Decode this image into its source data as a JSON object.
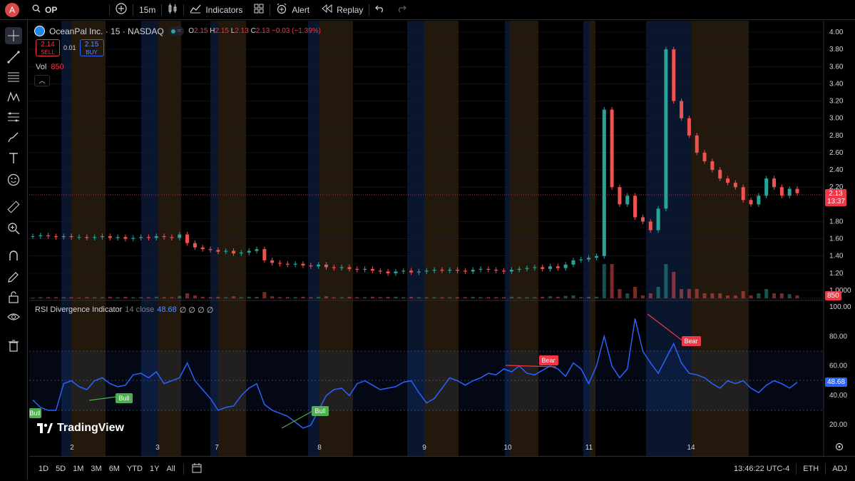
{
  "toolbar": {
    "avatar_letter": "A",
    "symbol": "OP",
    "interval": "15m",
    "indicators_label": "Indicators",
    "alert_label": "Alert",
    "replay_label": "Replay"
  },
  "legend": {
    "title": "OceanPal Inc. · 15 · NASDAQ",
    "o_label": "O",
    "o_val": "2.15",
    "h_label": "H",
    "h_val": "2.15",
    "l_label": "L",
    "l_val": "2.13",
    "c_label": "C",
    "c_val": "2.13",
    "change": "−0.03 (−1.39%)",
    "sell_price": "2.14",
    "sell_label": "SELL",
    "spread": "0.01",
    "buy_price": "2.15",
    "buy_label": "BUY",
    "vol_label": "Vol",
    "vol_val": "850"
  },
  "rsi_legend": {
    "name": "RSI Divergence Indicator",
    "params": "14 close",
    "value": "48.68",
    "zeros": "∅ ∅ ∅ ∅"
  },
  "brand": "TradingView",
  "price_axis": [
    "4.00",
    "3.80",
    "3.60",
    "3.40",
    "3.20",
    "3.00",
    "2.80",
    "2.60",
    "2.40",
    "2.20",
    "1.80",
    "1.60",
    "1.40",
    "1.20",
    "1.0000"
  ],
  "last_price": "2.13",
  "countdown": "13:37",
  "vol_tag": "850",
  "rsi_axis": [
    "100.00",
    "80.00",
    "60.00",
    "40.00",
    "20.00"
  ],
  "rsi_tag": "48.68",
  "time_axis": [
    "2",
    "3",
    "7",
    "8",
    "9",
    "10",
    "11",
    "14"
  ],
  "divergence_labels": [
    "Bull",
    "Bull",
    "Bear",
    "Bear"
  ],
  "bottom": {
    "ranges": [
      "1D",
      "5D",
      "1M",
      "3M",
      "6M",
      "YTD",
      "1Y",
      "All"
    ],
    "clock": "13:46:22 UTC-4",
    "session": "ETH",
    "adj": "ADJ"
  },
  "colors": {
    "up": "#26a69a",
    "down": "#ef5350",
    "rsi": "#2962ff",
    "bear": "#f23645",
    "bull": "#4caf50"
  },
  "chart_data": {
    "type": "candlestick",
    "price_range": [
      1.0,
      4.0
    ],
    "price_series": [
      1.63,
      1.64,
      1.63,
      1.62,
      1.63,
      1.62,
      1.62,
      1.61,
      1.62,
      1.63,
      1.61,
      1.62,
      1.6,
      1.61,
      1.62,
      1.61,
      1.63,
      1.62,
      1.61,
      1.65,
      1.55,
      1.5,
      1.48,
      1.47,
      1.45,
      1.46,
      1.43,
      1.44,
      1.46,
      1.48,
      1.35,
      1.32,
      1.31,
      1.3,
      1.31,
      1.29,
      1.28,
      1.3,
      1.27,
      1.26,
      1.27,
      1.25,
      1.24,
      1.25,
      1.23,
      1.22,
      1.2,
      1.22,
      1.23,
      1.21,
      1.22,
      1.23,
      1.24,
      1.23,
      1.24,
      1.23,
      1.22,
      1.24,
      1.25,
      1.24,
      1.23,
      1.22,
      1.24,
      1.25,
      1.26,
      1.27,
      1.25,
      1.28,
      1.26,
      1.3,
      1.35,
      1.36,
      1.38,
      1.4,
      3.1,
      2.2,
      2.0,
      2.1,
      1.85,
      1.8,
      1.7,
      1.95,
      3.8,
      3.2,
      3.0,
      2.8,
      2.6,
      2.5,
      2.4,
      2.3,
      2.25,
      2.2,
      2.05,
      2.0,
      2.1,
      2.3,
      2.2,
      2.1,
      2.18,
      2.13
    ],
    "rsi_range": [
      0,
      100
    ],
    "rsi_series": [
      37,
      32,
      30,
      30,
      48,
      50,
      46,
      44,
      50,
      52,
      48,
      46,
      47,
      54,
      55,
      52,
      56,
      48,
      50,
      52,
      62,
      50,
      44,
      38,
      30,
      32,
      33,
      40,
      45,
      48,
      34,
      30,
      28,
      26,
      22,
      18,
      20,
      30,
      40,
      44,
      45,
      40,
      48,
      50,
      47,
      44,
      45,
      46,
      49,
      50,
      42,
      35,
      38,
      45,
      52,
      50,
      47,
      50,
      52,
      55,
      54,
      58,
      56,
      60,
      55,
      54,
      57,
      60,
      58,
      53,
      62,
      58,
      48,
      60,
      80,
      60,
      52,
      58,
      92,
      70,
      62,
      55,
      65,
      75,
      62,
      55,
      54,
      52,
      48,
      45,
      50,
      48,
      50,
      45,
      42,
      47,
      50,
      48,
      45,
      49
    ],
    "overbought": 70,
    "oversold": 30,
    "x_ticks": [
      "2",
      "3",
      "7",
      "8",
      "9",
      "10",
      "11",
      "14"
    ]
  }
}
